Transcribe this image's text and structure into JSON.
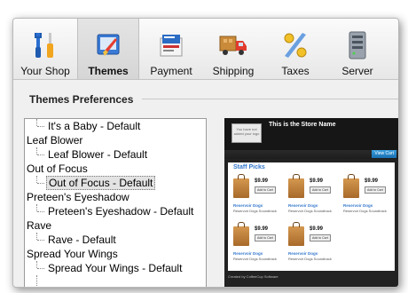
{
  "tabs": [
    {
      "label": "Your Shop",
      "icon": "tools-icon"
    },
    {
      "label": "Themes",
      "icon": "paintbrush-icon"
    },
    {
      "label": "Payment",
      "icon": "payment-icon"
    },
    {
      "label": "Shipping",
      "icon": "truck-icon"
    },
    {
      "label": "Taxes",
      "icon": "percent-icon"
    },
    {
      "label": "Server",
      "icon": "server-icon"
    }
  ],
  "active_tab": "Themes",
  "section_title": "Themes Preferences",
  "tree": [
    {
      "label": "It's a Baby - Default",
      "level": 1
    },
    {
      "label": "Leaf Blower",
      "level": 0
    },
    {
      "label": "Leaf Blower - Default",
      "level": 1
    },
    {
      "label": "Out of Focus",
      "level": 0
    },
    {
      "label": "Out of Focus - Default",
      "level": 1,
      "selected": true
    },
    {
      "label": "Preteen's Eyeshadow",
      "level": 0
    },
    {
      "label": "Preteen's Eyeshadow - Default",
      "level": 1
    },
    {
      "label": "Rave",
      "level": 0
    },
    {
      "label": "Rave - Default",
      "level": 1
    },
    {
      "label": "Spread Your Wings",
      "level": 0
    },
    {
      "label": "Spread Your Wings - Default",
      "level": 1
    }
  ],
  "preview": {
    "store_name": "This is the Store Name",
    "logo_text": "You have not added your logo",
    "cart_button": "View Cart",
    "staff_picks": "Staff Picks",
    "price": "$9.99",
    "add_to_cart": "Add to Cart",
    "item_name": "Reservoir Dogs",
    "item_sub": "Reservoir Dogs Soundtrack",
    "footer": "Created by CoffeeCup Software"
  }
}
